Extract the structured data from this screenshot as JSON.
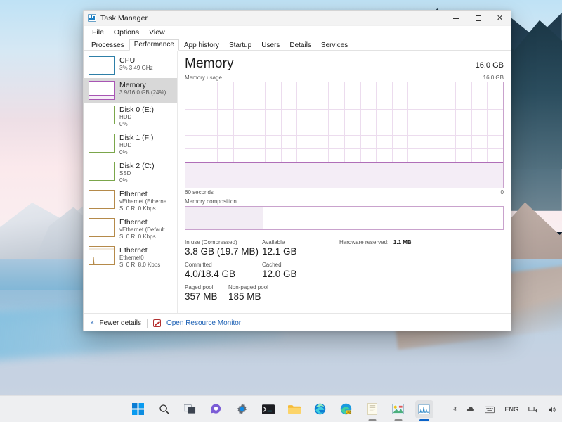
{
  "window": {
    "title": "Task Manager",
    "app_icon": "task-manager-icon",
    "controls": {
      "minimize": "–",
      "maximize": "□",
      "close": "×"
    }
  },
  "menubar": {
    "items": [
      "File",
      "Options",
      "View"
    ]
  },
  "tabs": {
    "items": [
      "Processes",
      "Performance",
      "App history",
      "Startup",
      "Users",
      "Details",
      "Services"
    ],
    "selected": "Performance"
  },
  "sidebar": {
    "items": [
      {
        "title": "CPU",
        "sub1": "3% 3.49 GHz",
        "sub2": "",
        "accent": "#2e7fa8",
        "fill": 6,
        "selected": false
      },
      {
        "title": "Memory",
        "sub1": "3.9/16.0 GB (24%)",
        "sub2": "",
        "accent": "#a855b4",
        "fill": 24,
        "selected": true
      },
      {
        "title": "Disk 0 (E:)",
        "sub1": "HDD",
        "sub2": "0%",
        "accent": "#7ba64b",
        "fill": 0,
        "selected": false
      },
      {
        "title": "Disk 1 (F:)",
        "sub1": "HDD",
        "sub2": "0%",
        "accent": "#7ba64b",
        "fill": 0,
        "selected": false
      },
      {
        "title": "Disk 2 (C:)",
        "sub1": "SSD",
        "sub2": "0%",
        "accent": "#7ba64b",
        "fill": 0,
        "selected": false
      },
      {
        "title": "Ethernet",
        "sub1": "vEthernet (Etherne..",
        "sub2": "S: 0 R: 0 Kbps",
        "accent": "#b58a4a",
        "fill": 0,
        "selected": false
      },
      {
        "title": "Ethernet",
        "sub1": "vEthernet (Default ...",
        "sub2": "S: 0 R: 0 Kbps",
        "accent": "#b58a4a",
        "fill": 0,
        "selected": false
      },
      {
        "title": "Ethernet",
        "sub1": "Ethernet0",
        "sub2": "S: 0 R: 8.0 Kbps",
        "accent": "#b58a4a",
        "fill": 0,
        "selected": false
      }
    ]
  },
  "main": {
    "title": "Memory",
    "total_right": "16.0 GB",
    "graph_label": "Memory usage",
    "graph_max_label": "16.0 GB",
    "axis_left": "60 seconds",
    "axis_right": "0",
    "composition_label": "Memory composition",
    "stats": {
      "row1": [
        {
          "label": "In use (Compressed)",
          "value": "3.8 GB (19.7 MB)"
        },
        {
          "label": "Available",
          "value": "12.1 GB"
        }
      ],
      "hardware_reserved_label": "Hardware reserved:",
      "hardware_reserved_value": "1.1 MB",
      "row2": [
        {
          "label": "Committed",
          "value": "4.0/18.4 GB"
        },
        {
          "label": "Cached",
          "value": "12.0 GB"
        }
      ],
      "row3": [
        {
          "label": "Paged pool",
          "value": "357 MB"
        },
        {
          "label": "Non-paged pool",
          "value": "185 MB"
        }
      ]
    }
  },
  "footer": {
    "chevron": "ⱏ",
    "fewer_details": "Fewer details",
    "resource_monitor": "Open Resource Monitor"
  },
  "taskbar": {
    "buttons": [
      {
        "name": "start-icon",
        "label": "Start"
      },
      {
        "name": "search-icon",
        "label": "Search"
      },
      {
        "name": "task-view-icon",
        "label": "Task View"
      },
      {
        "name": "chat-icon",
        "label": "Chat"
      },
      {
        "name": "settings-gear-icon",
        "label": "Settings"
      },
      {
        "name": "terminal-icon",
        "label": "Terminal"
      },
      {
        "name": "file-explorer-icon",
        "label": "File Explorer"
      },
      {
        "name": "edge-browser-icon",
        "label": "Microsoft Edge"
      },
      {
        "name": "cab-installer-icon",
        "label": "CAB Installer"
      },
      {
        "name": "notepad-icon",
        "label": "Notepad"
      },
      {
        "name": "paint-icon",
        "label": "Paint"
      },
      {
        "name": "task-manager-icon",
        "label": "Task Manager"
      }
    ],
    "tray": {
      "overflow": "ⱏ",
      "cloud_icon": "cloud-icon",
      "keyboard_icon": "keyboard-icon",
      "language": "ENG",
      "network_icon": "network-icon",
      "volume_icon": "volume-icon"
    }
  },
  "chart_data": {
    "type": "area",
    "title": "Memory usage",
    "ylabel": "16.0 GB",
    "xlabel": "60 seconds",
    "ylim": [
      0,
      16.0
    ],
    "xlim": [
      60,
      0
    ],
    "series": [
      {
        "name": "Memory in use (GB)",
        "values": [
          3.9,
          3.9,
          3.9,
          3.9,
          3.9,
          3.9,
          3.9,
          3.9,
          3.9,
          3.9,
          3.9,
          3.9,
          3.9,
          3.9,
          3.9,
          3.9,
          3.9,
          3.9,
          3.9,
          3.9,
          3.9,
          3.9,
          3.9,
          3.9,
          3.9,
          3.9,
          3.9,
          3.9,
          3.9,
          3.9
        ]
      }
    ],
    "fill_percent": 24,
    "grid": true,
    "accent": "#b06fb8",
    "composition": {
      "type": "bar",
      "segments": [
        {
          "name": "In use",
          "percent": 24.5,
          "color": "#f2ecf4"
        },
        {
          "name": "Available",
          "percent": 75.5,
          "color": "#ffffff"
        }
      ]
    }
  }
}
